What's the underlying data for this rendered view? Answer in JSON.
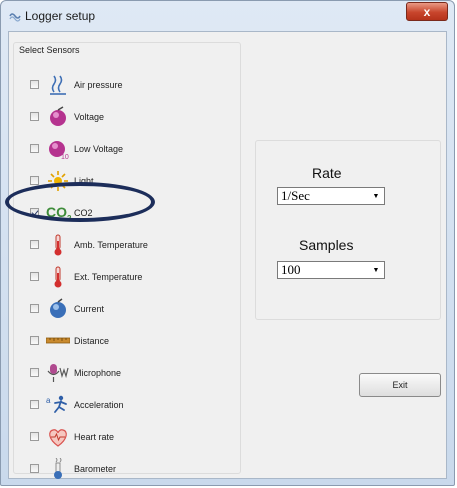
{
  "window": {
    "title": "Logger setup",
    "close_label": "x"
  },
  "sensors": {
    "group_label": "Select Sensors",
    "items": [
      {
        "label": "Air pressure",
        "checked": false,
        "icon": "air-pressure-icon"
      },
      {
        "label": "Voltage",
        "checked": false,
        "icon": "voltage-icon"
      },
      {
        "label": "Low Voltage",
        "checked": false,
        "icon": "low-voltage-icon"
      },
      {
        "label": "Light",
        "checked": false,
        "icon": "light-icon"
      },
      {
        "label": "CO2",
        "checked": true,
        "icon": "co2-icon",
        "icon_text": "CO",
        "icon_sub": "2"
      },
      {
        "label": "Amb. Temperature",
        "checked": false,
        "icon": "thermometer-icon"
      },
      {
        "label": "Ext. Temperature",
        "checked": false,
        "icon": "thermometer-icon"
      },
      {
        "label": "Current",
        "checked": false,
        "icon": "current-icon"
      },
      {
        "label": "Distance",
        "checked": false,
        "icon": "distance-icon"
      },
      {
        "label": "Microphone",
        "checked": false,
        "icon": "microphone-icon"
      },
      {
        "label": "Acceleration",
        "checked": false,
        "icon": "acceleration-icon"
      },
      {
        "label": "Heart rate",
        "checked": false,
        "icon": "heart-rate-icon"
      },
      {
        "label": "Barometer",
        "checked": false,
        "icon": "barometer-icon"
      }
    ]
  },
  "settings": {
    "rate_label": "Rate",
    "rate_value": "1/Sec",
    "samples_label": "Samples",
    "samples_value": "100"
  },
  "exit_label": "Exit",
  "colors": {
    "highlight": "#1c2d5a",
    "close_button": "#c8452c",
    "co2_green": "#3e8c3a"
  }
}
